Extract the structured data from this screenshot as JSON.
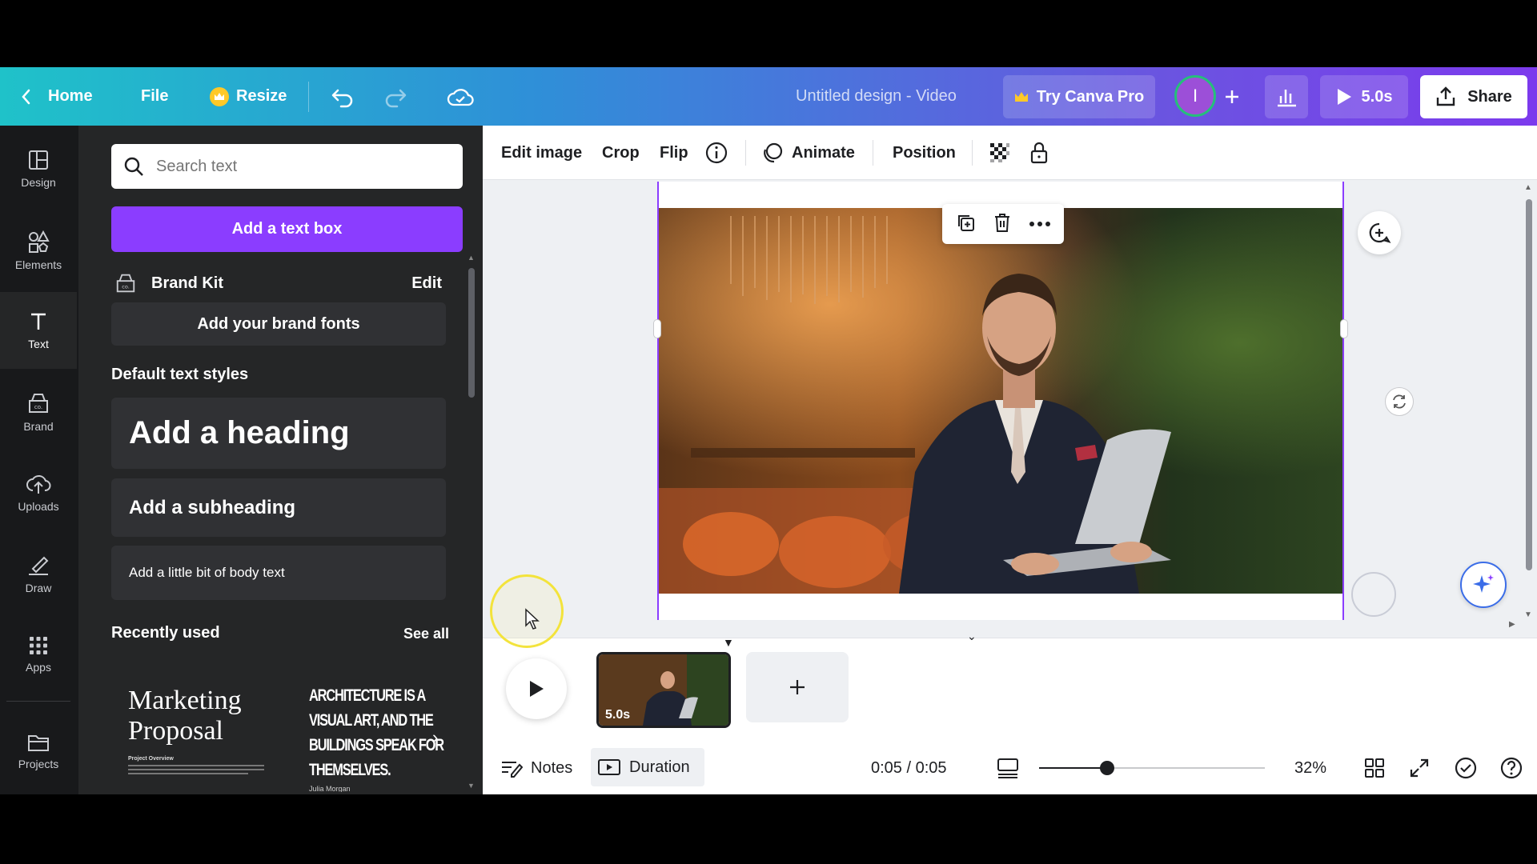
{
  "topbar": {
    "home": "Home",
    "file": "File",
    "resize": "Resize",
    "title": "Untitled design - Video",
    "try_pro": "Try Canva Pro",
    "avatar_initial": "I",
    "play_duration": "5.0s",
    "share": "Share"
  },
  "rail": [
    {
      "label": "Design",
      "icon": "layout-icon"
    },
    {
      "label": "Elements",
      "icon": "shapes-icon"
    },
    {
      "label": "Text",
      "icon": "text-icon"
    },
    {
      "label": "Brand",
      "icon": "brand-icon"
    },
    {
      "label": "Uploads",
      "icon": "cloud-upload-icon"
    },
    {
      "label": "Draw",
      "icon": "pen-icon"
    },
    {
      "label": "Apps",
      "icon": "grid-icon"
    },
    {
      "label": "Projects",
      "icon": "folder-icon"
    }
  ],
  "panel": {
    "search_placeholder": "Search text",
    "add_text_box": "Add a text box",
    "brand_kit": "Brand Kit",
    "brand_edit": "Edit",
    "add_brand_fonts": "Add your brand fonts",
    "default_styles": "Default text styles",
    "heading": "Add a heading",
    "subheading": "Add a subheading",
    "body": "Add a little bit of body text",
    "recently_used": "Recently used",
    "see_all": "See all",
    "template1_line1": "Marketing",
    "template1_line2": "Proposal",
    "template1_caption": "Project Overview",
    "template2_lines": [
      "ARCHITECTURE IS A",
      "VISUAL ART, AND THE",
      "BUILDINGS SPEAK FOR",
      "THEMSELVES."
    ],
    "template2_author": "Julia Morgan"
  },
  "context_toolbar": {
    "edit_image": "Edit image",
    "crop": "Crop",
    "flip": "Flip",
    "animate": "Animate",
    "position": "Position"
  },
  "timeline": {
    "page_duration": "5.0s",
    "notes": "Notes",
    "duration": "Duration",
    "time": "0:05 / 0:05",
    "zoom": "32%",
    "zoom_level": 0.3
  },
  "colors": {
    "accent": "#8b3dff",
    "rail_bg": "#18191b",
    "panel_bg": "#252627"
  }
}
